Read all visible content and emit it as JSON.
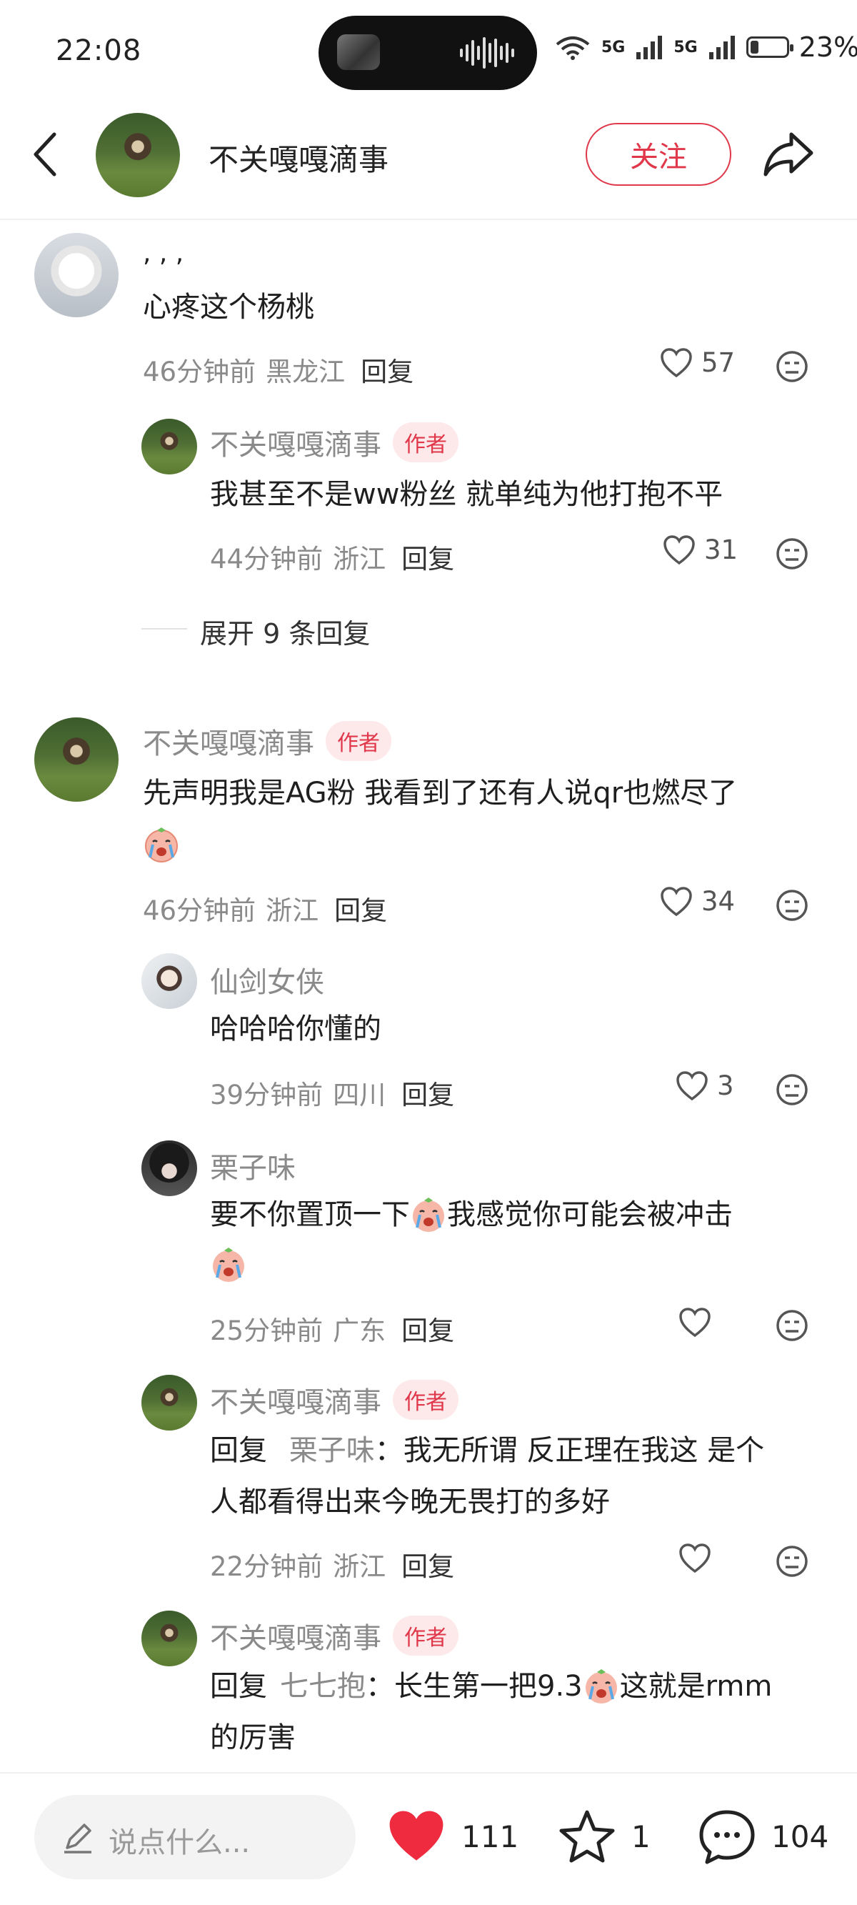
{
  "status_bar": {
    "time": "22:08",
    "signal_a": "5G",
    "signal_b": "5G",
    "battery": "23%",
    "battery_level": 0.23
  },
  "header": {
    "title": "不关嘎嘎滴事",
    "follow_label": "关注"
  },
  "comments": [
    {
      "text_line1": ", , ,",
      "text_line2": "心疼这个杨桃",
      "time": "46分钟前",
      "location": "黑龙江",
      "reply": "回复",
      "likes": "57",
      "replies": [
        {
          "name": "不关嘎嘎滴事",
          "badge": "作者",
          "text": "我甚至不是ww粉丝 就单纯为他打抱不平",
          "time": "44分钟前",
          "location": "浙江",
          "reply": "回复",
          "likes": "31"
        }
      ],
      "expand_label": "展开 9 条回复"
    },
    {
      "name": "不关嘎嘎滴事",
      "badge": "作者",
      "text": "先声明我是AG粉 我看到了还有人说qr也燃尽了",
      "time": "46分钟前",
      "location": "浙江",
      "reply": "回复",
      "likes": "34",
      "replies": [
        {
          "name": "仙剑女侠",
          "text": "哈哈哈你懂的",
          "time": "39分钟前",
          "location": "四川",
          "reply": "回复",
          "likes": "3"
        },
        {
          "name": "栗子味",
          "text_a": "要不你置顶一下",
          "text_b": "我感觉你可能会被冲击",
          "time": "25分钟前",
          "location": "广东",
          "reply": "回复"
        },
        {
          "name": "不关嘎嘎滴事",
          "badge": "作者",
          "prefix": "回复",
          "target": "栗子味",
          "line1": "：我无所谓 反正理在我这 是个",
          "line2": "人都看得出来今晚无畏打的多好",
          "time": "22分钟前",
          "location": "浙江",
          "reply": "回复"
        },
        {
          "name": "不关嘎嘎滴事",
          "badge": "作者",
          "prefix": "回复",
          "target": "七七抱",
          "line1a": "：长生第一把9.3",
          "line1b": "这就是rmm",
          "line2": "的厉害"
        }
      ]
    }
  ],
  "bottom_bar": {
    "placeholder": "说点什么...",
    "likes": "111",
    "favorites": "1",
    "comments": "104"
  },
  "colors": {
    "accent": "#e0384a",
    "badge_bg": "#fde8ea",
    "meta": "#8a8a8a"
  },
  "icons": [
    "back-icon",
    "share-icon",
    "heart-icon",
    "dislike-face-icon",
    "crying-emoji-icon",
    "pencil-icon",
    "star-icon",
    "comment-bubble-icon"
  ]
}
